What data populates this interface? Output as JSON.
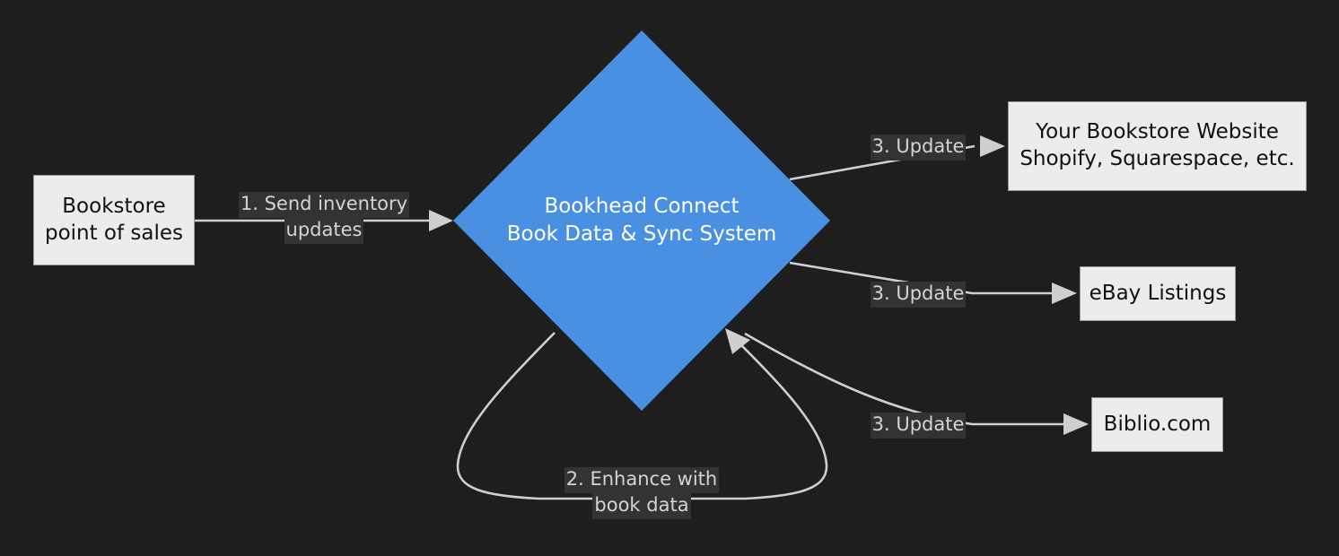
{
  "diagram": {
    "type": "flowchart",
    "title": "Bookhead Connect Book Data & Sync System",
    "background_color": "#1e1e1f",
    "node_fill": "#ececec",
    "node_border": "#999999",
    "accent_color": "#4a90e2",
    "edge_color": "#cfcfcf",
    "edge_label_chip_color": "#333333",
    "edge_label_text_color": "#d4d4d4"
  },
  "nodes": {
    "pos": {
      "id": "bookstore-pos",
      "shape": "rectangle",
      "line1": "Bookstore",
      "line2": "point of sales"
    },
    "hub": {
      "id": "bookhead-connect",
      "shape": "diamond",
      "line1": "Bookhead Connect",
      "line2": "Book Data & Sync System"
    },
    "website": {
      "id": "bookstore-website",
      "shape": "rectangle",
      "line1": "Your Bookstore Website",
      "line2": "Shopify, Squarespace, etc."
    },
    "ebay": {
      "id": "ebay-listings",
      "shape": "rectangle",
      "line1": "eBay Listings"
    },
    "biblio": {
      "id": "biblio-com",
      "shape": "rectangle",
      "line1": "Biblio.com"
    }
  },
  "edges": {
    "pos_to_hub": {
      "from": "bookstore-pos",
      "to": "bookhead-connect",
      "line1": "1. Send inventory",
      "line2": "updates"
    },
    "hub_self_loop": {
      "from": "bookhead-connect",
      "to": "bookhead-connect",
      "line1": "2. Enhance with",
      "line2": "book data"
    },
    "hub_to_website": {
      "from": "bookhead-connect",
      "to": "bookstore-website",
      "line1": "3. Update"
    },
    "hub_to_ebay": {
      "from": "bookhead-connect",
      "to": "ebay-listings",
      "line1": "3. Update"
    },
    "hub_to_biblio": {
      "from": "bookhead-connect",
      "to": "biblio-com",
      "line1": "3. Update"
    }
  }
}
